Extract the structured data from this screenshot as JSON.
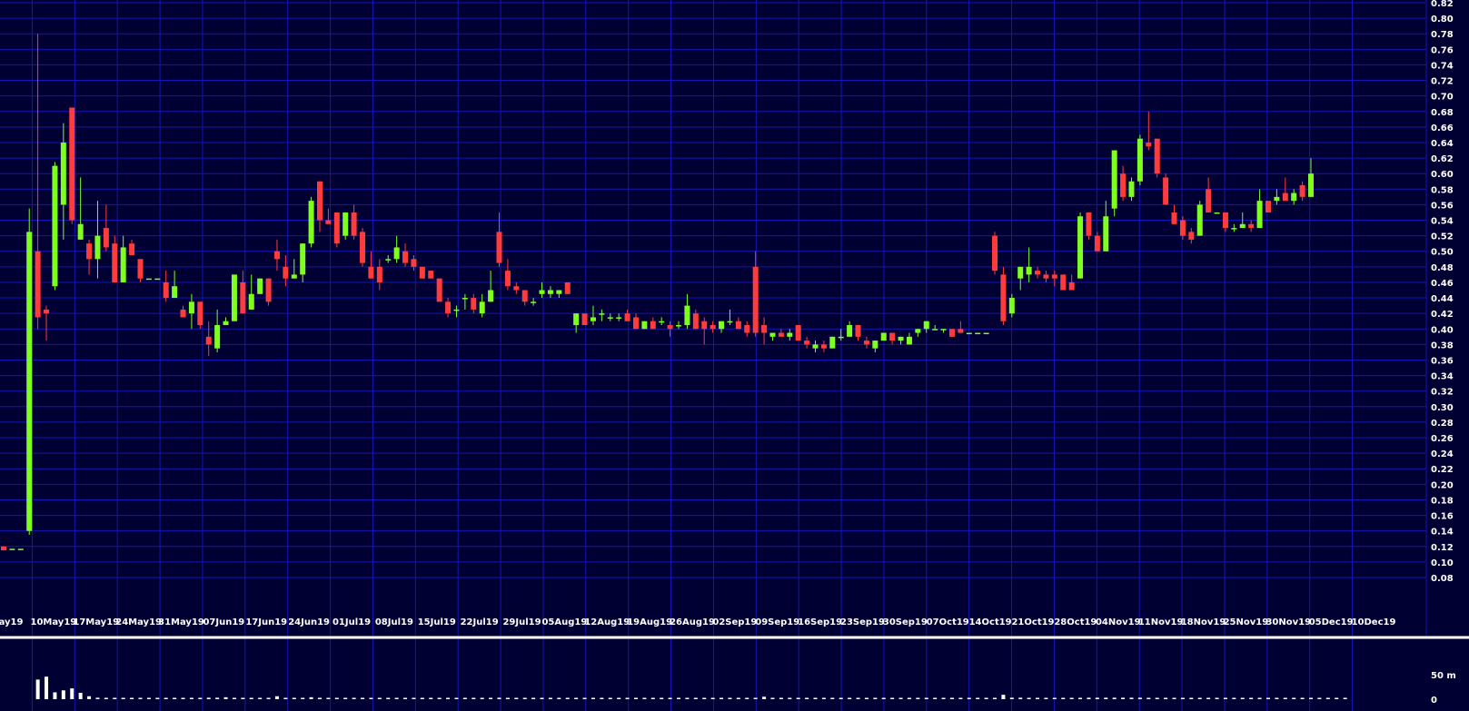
{
  "chart_data": {
    "type": "candlestick",
    "price_axis": {
      "min": 0.08,
      "max": 0.82,
      "tick_step": 0.02,
      "tick_labels": [
        "0.82",
        "0.80",
        "0.78",
        "0.76",
        "0.74",
        "0.72",
        "0.70",
        "0.68",
        "0.66",
        "0.64",
        "0.62",
        "0.60",
        "0.58",
        "0.56",
        "0.54",
        "0.52",
        "0.50",
        "0.48",
        "0.46",
        "0.44",
        "0.42",
        "0.40",
        "0.38",
        "0.36",
        "0.34",
        "0.32",
        "0.30",
        "0.28",
        "0.26",
        "0.24",
        "0.22",
        "0.20",
        "0.18",
        "0.16",
        "0.14",
        "0.12",
        "0.10",
        "0.08"
      ],
      "grid": true
    },
    "date_axis": {
      "labels": [
        "ay19",
        "10May19",
        "17May19",
        "24May19",
        "31May19",
        "07Jun19",
        "17Jun19",
        "24Jun19",
        "01Jul19",
        "08Jul19",
        "15Jul19",
        "22Jul19",
        "29Jul19",
        "05Aug19",
        "12Aug19",
        "19Aug19",
        "26Aug19",
        "02Sep19",
        "09Sep19",
        "16Sep19",
        "23Sep19",
        "30Sep19",
        "07Oct19",
        "14Oct19",
        "21Oct19",
        "28Oct19",
        "04Nov19",
        "11Nov19",
        "18Nov19",
        "25Nov19",
        "30Nov19",
        "05Dec19",
        "10Dec19"
      ]
    },
    "candles": [
      {
        "o": 0.12,
        "h": 0.12,
        "l": 0.115,
        "c": 0.115
      },
      {
        "o": 0.117,
        "h": 0.117,
        "l": 0.117,
        "c": 0.117
      },
      {
        "o": 0.117,
        "h": 0.117,
        "l": 0.117,
        "c": 0.117
      },
      {
        "o": 0.14,
        "h": 0.555,
        "l": 0.135,
        "c": 0.525
      },
      {
        "o": 0.5,
        "h": 0.78,
        "l": 0.4,
        "c": 0.415
      },
      {
        "o": 0.425,
        "h": 0.43,
        "l": 0.385,
        "c": 0.42
      },
      {
        "o": 0.455,
        "h": 0.615,
        "l": 0.45,
        "c": 0.61
      },
      {
        "o": 0.56,
        "h": 0.665,
        "l": 0.515,
        "c": 0.64
      },
      {
        "o": 0.685,
        "h": 0.685,
        "l": 0.535,
        "c": 0.54
      },
      {
        "o": 0.515,
        "h": 0.595,
        "l": 0.515,
        "c": 0.535
      },
      {
        "o": 0.51,
        "h": 0.515,
        "l": 0.47,
        "c": 0.49
      },
      {
        "o": 0.49,
        "h": 0.565,
        "l": 0.465,
        "c": 0.52
      },
      {
        "o": 0.53,
        "h": 0.56,
        "l": 0.5,
        "c": 0.505
      },
      {
        "o": 0.51,
        "h": 0.52,
        "l": 0.46,
        "c": 0.46
      },
      {
        "o": 0.46,
        "h": 0.52,
        "l": 0.46,
        "c": 0.505
      },
      {
        "o": 0.51,
        "h": 0.515,
        "l": 0.495,
        "c": 0.495
      },
      {
        "o": 0.49,
        "h": 0.49,
        "l": 0.46,
        "c": 0.465
      },
      {
        "o": 0.465,
        "h": 0.465,
        "l": 0.465,
        "c": 0.465
      },
      {
        "o": 0.465,
        "h": 0.465,
        "l": 0.465,
        "c": 0.465
      },
      {
        "o": 0.46,
        "h": 0.475,
        "l": 0.435,
        "c": 0.44
      },
      {
        "o": 0.44,
        "h": 0.475,
        "l": 0.44,
        "c": 0.455
      },
      {
        "o": 0.425,
        "h": 0.43,
        "l": 0.415,
        "c": 0.415
      },
      {
        "o": 0.42,
        "h": 0.445,
        "l": 0.4,
        "c": 0.435
      },
      {
        "o": 0.435,
        "h": 0.435,
        "l": 0.4,
        "c": 0.405
      },
      {
        "o": 0.39,
        "h": 0.41,
        "l": 0.365,
        "c": 0.38
      },
      {
        "o": 0.375,
        "h": 0.425,
        "l": 0.37,
        "c": 0.405
      },
      {
        "o": 0.405,
        "h": 0.415,
        "l": 0.405,
        "c": 0.41
      },
      {
        "o": 0.41,
        "h": 0.47,
        "l": 0.41,
        "c": 0.47
      },
      {
        "o": 0.46,
        "h": 0.475,
        "l": 0.42,
        "c": 0.42
      },
      {
        "o": 0.425,
        "h": 0.47,
        "l": 0.425,
        "c": 0.445
      },
      {
        "o": 0.445,
        "h": 0.465,
        "l": 0.445,
        "c": 0.465
      },
      {
        "o": 0.465,
        "h": 0.465,
        "l": 0.43,
        "c": 0.435
      },
      {
        "o": 0.5,
        "h": 0.515,
        "l": 0.475,
        "c": 0.49
      },
      {
        "o": 0.48,
        "h": 0.495,
        "l": 0.455,
        "c": 0.465
      },
      {
        "o": 0.465,
        "h": 0.49,
        "l": 0.465,
        "c": 0.47
      },
      {
        "o": 0.47,
        "h": 0.51,
        "l": 0.46,
        "c": 0.51
      },
      {
        "o": 0.51,
        "h": 0.57,
        "l": 0.505,
        "c": 0.565
      },
      {
        "o": 0.59,
        "h": 0.59,
        "l": 0.525,
        "c": 0.54
      },
      {
        "o": 0.54,
        "h": 0.555,
        "l": 0.535,
        "c": 0.535
      },
      {
        "o": 0.55,
        "h": 0.55,
        "l": 0.505,
        "c": 0.51
      },
      {
        "o": 0.52,
        "h": 0.55,
        "l": 0.515,
        "c": 0.55
      },
      {
        "o": 0.55,
        "h": 0.56,
        "l": 0.515,
        "c": 0.52
      },
      {
        "o": 0.525,
        "h": 0.53,
        "l": 0.48,
        "c": 0.485
      },
      {
        "o": 0.48,
        "h": 0.5,
        "l": 0.465,
        "c": 0.465
      },
      {
        "o": 0.48,
        "h": 0.49,
        "l": 0.45,
        "c": 0.46
      },
      {
        "o": 0.49,
        "h": 0.495,
        "l": 0.485,
        "c": 0.49
      },
      {
        "o": 0.49,
        "h": 0.52,
        "l": 0.485,
        "c": 0.505
      },
      {
        "o": 0.5,
        "h": 0.51,
        "l": 0.48,
        "c": 0.485
      },
      {
        "o": 0.49,
        "h": 0.495,
        "l": 0.475,
        "c": 0.48
      },
      {
        "o": 0.48,
        "h": 0.48,
        "l": 0.465,
        "c": 0.465
      },
      {
        "o": 0.475,
        "h": 0.475,
        "l": 0.465,
        "c": 0.465
      },
      {
        "o": 0.465,
        "h": 0.465,
        "l": 0.435,
        "c": 0.435
      },
      {
        "o": 0.435,
        "h": 0.44,
        "l": 0.415,
        "c": 0.42
      },
      {
        "o": 0.425,
        "h": 0.43,
        "l": 0.415,
        "c": 0.425
      },
      {
        "o": 0.44,
        "h": 0.445,
        "l": 0.425,
        "c": 0.44
      },
      {
        "o": 0.44,
        "h": 0.445,
        "l": 0.42,
        "c": 0.425
      },
      {
        "o": 0.42,
        "h": 0.445,
        "l": 0.415,
        "c": 0.435
      },
      {
        "o": 0.435,
        "h": 0.475,
        "l": 0.435,
        "c": 0.45
      },
      {
        "o": 0.525,
        "h": 0.55,
        "l": 0.48,
        "c": 0.485
      },
      {
        "o": 0.475,
        "h": 0.49,
        "l": 0.45,
        "c": 0.455
      },
      {
        "o": 0.455,
        "h": 0.46,
        "l": 0.445,
        "c": 0.45
      },
      {
        "o": 0.45,
        "h": 0.45,
        "l": 0.43,
        "c": 0.435
      },
      {
        "o": 0.435,
        "h": 0.44,
        "l": 0.43,
        "c": 0.435
      },
      {
        "o": 0.445,
        "h": 0.46,
        "l": 0.44,
        "c": 0.45
      },
      {
        "o": 0.445,
        "h": 0.455,
        "l": 0.44,
        "c": 0.45
      },
      {
        "o": 0.445,
        "h": 0.45,
        "l": 0.44,
        "c": 0.45
      },
      {
        "o": 0.46,
        "h": 0.46,
        "l": 0.445,
        "c": 0.445
      },
      {
        "o": 0.405,
        "h": 0.42,
        "l": 0.395,
        "c": 0.42
      },
      {
        "o": 0.42,
        "h": 0.42,
        "l": 0.405,
        "c": 0.405
      },
      {
        "o": 0.41,
        "h": 0.43,
        "l": 0.405,
        "c": 0.415
      },
      {
        "o": 0.42,
        "h": 0.425,
        "l": 0.41,
        "c": 0.42
      },
      {
        "o": 0.415,
        "h": 0.42,
        "l": 0.41,
        "c": 0.415
      },
      {
        "o": 0.415,
        "h": 0.42,
        "l": 0.41,
        "c": 0.415
      },
      {
        "o": 0.42,
        "h": 0.425,
        "l": 0.41,
        "c": 0.41
      },
      {
        "o": 0.415,
        "h": 0.42,
        "l": 0.4,
        "c": 0.4
      },
      {
        "o": 0.4,
        "h": 0.41,
        "l": 0.4,
        "c": 0.41
      },
      {
        "o": 0.41,
        "h": 0.415,
        "l": 0.4,
        "c": 0.4
      },
      {
        "o": 0.41,
        "h": 0.415,
        "l": 0.405,
        "c": 0.41
      },
      {
        "o": 0.405,
        "h": 0.41,
        "l": 0.39,
        "c": 0.4
      },
      {
        "o": 0.405,
        "h": 0.41,
        "l": 0.4,
        "c": 0.405
      },
      {
        "o": 0.405,
        "h": 0.445,
        "l": 0.4,
        "c": 0.43
      },
      {
        "o": 0.42,
        "h": 0.425,
        "l": 0.4,
        "c": 0.4
      },
      {
        "o": 0.41,
        "h": 0.415,
        "l": 0.38,
        "c": 0.4
      },
      {
        "o": 0.405,
        "h": 0.41,
        "l": 0.395,
        "c": 0.4
      },
      {
        "o": 0.4,
        "h": 0.41,
        "l": 0.395,
        "c": 0.41
      },
      {
        "o": 0.41,
        "h": 0.425,
        "l": 0.405,
        "c": 0.41
      },
      {
        "o": 0.41,
        "h": 0.415,
        "l": 0.4,
        "c": 0.4
      },
      {
        "o": 0.405,
        "h": 0.41,
        "l": 0.39,
        "c": 0.395
      },
      {
        "o": 0.48,
        "h": 0.5,
        "l": 0.39,
        "c": 0.395
      },
      {
        "o": 0.405,
        "h": 0.415,
        "l": 0.38,
        "c": 0.395
      },
      {
        "o": 0.39,
        "h": 0.395,
        "l": 0.385,
        "c": 0.395
      },
      {
        "o": 0.395,
        "h": 0.4,
        "l": 0.39,
        "c": 0.39
      },
      {
        "o": 0.39,
        "h": 0.4,
        "l": 0.385,
        "c": 0.395
      },
      {
        "o": 0.405,
        "h": 0.405,
        "l": 0.385,
        "c": 0.385
      },
      {
        "o": 0.385,
        "h": 0.39,
        "l": 0.375,
        "c": 0.38
      },
      {
        "o": 0.375,
        "h": 0.385,
        "l": 0.37,
        "c": 0.38
      },
      {
        "o": 0.38,
        "h": 0.385,
        "l": 0.37,
        "c": 0.375
      },
      {
        "o": 0.375,
        "h": 0.39,
        "l": 0.375,
        "c": 0.39
      },
      {
        "o": 0.39,
        "h": 0.4,
        "l": 0.385,
        "c": 0.39
      },
      {
        "o": 0.39,
        "h": 0.41,
        "l": 0.39,
        "c": 0.405
      },
      {
        "o": 0.405,
        "h": 0.405,
        "l": 0.385,
        "c": 0.39
      },
      {
        "o": 0.385,
        "h": 0.39,
        "l": 0.375,
        "c": 0.38
      },
      {
        "o": 0.375,
        "h": 0.385,
        "l": 0.37,
        "c": 0.385
      },
      {
        "o": 0.385,
        "h": 0.395,
        "l": 0.385,
        "c": 0.395
      },
      {
        "o": 0.395,
        "h": 0.395,
        "l": 0.38,
        "c": 0.385
      },
      {
        "o": 0.385,
        "h": 0.39,
        "l": 0.38,
        "c": 0.39
      },
      {
        "o": 0.38,
        "h": 0.395,
        "l": 0.38,
        "c": 0.39
      },
      {
        "o": 0.395,
        "h": 0.4,
        "l": 0.39,
        "c": 0.4
      },
      {
        "o": 0.4,
        "h": 0.41,
        "l": 0.395,
        "c": 0.41
      },
      {
        "o": 0.4,
        "h": 0.405,
        "l": 0.4,
        "c": 0.4
      },
      {
        "o": 0.4,
        "h": 0.4,
        "l": 0.395,
        "c": 0.4
      },
      {
        "o": 0.4,
        "h": 0.4,
        "l": 0.39,
        "c": 0.39
      },
      {
        "o": 0.4,
        "h": 0.41,
        "l": 0.395,
        "c": 0.395
      },
      {
        "o": 0.395,
        "h": 0.395,
        "l": 0.395,
        "c": 0.395
      },
      {
        "o": 0.395,
        "h": 0.395,
        "l": 0.395,
        "c": 0.395
      },
      {
        "o": 0.395,
        "h": 0.395,
        "l": 0.395,
        "c": 0.395
      },
      {
        "o": 0.52,
        "h": 0.525,
        "l": 0.47,
        "c": 0.475
      },
      {
        "o": 0.47,
        "h": 0.48,
        "l": 0.405,
        "c": 0.41
      },
      {
        "o": 0.42,
        "h": 0.445,
        "l": 0.415,
        "c": 0.44
      },
      {
        "o": 0.465,
        "h": 0.48,
        "l": 0.45,
        "c": 0.48
      },
      {
        "o": 0.47,
        "h": 0.505,
        "l": 0.46,
        "c": 0.48
      },
      {
        "o": 0.475,
        "h": 0.48,
        "l": 0.465,
        "c": 0.47
      },
      {
        "o": 0.47,
        "h": 0.475,
        "l": 0.46,
        "c": 0.465
      },
      {
        "o": 0.47,
        "h": 0.475,
        "l": 0.455,
        "c": 0.465
      },
      {
        "o": 0.47,
        "h": 0.47,
        "l": 0.45,
        "c": 0.45
      },
      {
        "o": 0.46,
        "h": 0.47,
        "l": 0.45,
        "c": 0.45
      },
      {
        "o": 0.465,
        "h": 0.55,
        "l": 0.465,
        "c": 0.545
      },
      {
        "o": 0.55,
        "h": 0.55,
        "l": 0.515,
        "c": 0.52
      },
      {
        "o": 0.52,
        "h": 0.525,
        "l": 0.5,
        "c": 0.5
      },
      {
        "o": 0.5,
        "h": 0.565,
        "l": 0.5,
        "c": 0.545
      },
      {
        "o": 0.555,
        "h": 0.63,
        "l": 0.545,
        "c": 0.63
      },
      {
        "o": 0.6,
        "h": 0.61,
        "l": 0.565,
        "c": 0.57
      },
      {
        "o": 0.57,
        "h": 0.595,
        "l": 0.565,
        "c": 0.59
      },
      {
        "o": 0.59,
        "h": 0.65,
        "l": 0.585,
        "c": 0.645
      },
      {
        "o": 0.64,
        "h": 0.68,
        "l": 0.63,
        "c": 0.635
      },
      {
        "o": 0.645,
        "h": 0.645,
        "l": 0.595,
        "c": 0.6
      },
      {
        "o": 0.595,
        "h": 0.6,
        "l": 0.56,
        "c": 0.56
      },
      {
        "o": 0.55,
        "h": 0.56,
        "l": 0.535,
        "c": 0.535
      },
      {
        "o": 0.54,
        "h": 0.545,
        "l": 0.515,
        "c": 0.52
      },
      {
        "o": 0.525,
        "h": 0.53,
        "l": 0.51,
        "c": 0.515
      },
      {
        "o": 0.52,
        "h": 0.565,
        "l": 0.52,
        "c": 0.56
      },
      {
        "o": 0.58,
        "h": 0.595,
        "l": 0.55,
        "c": 0.55
      },
      {
        "o": 0.55,
        "h": 0.55,
        "l": 0.55,
        "c": 0.55
      },
      {
        "o": 0.55,
        "h": 0.55,
        "l": 0.525,
        "c": 0.53
      },
      {
        "o": 0.53,
        "h": 0.535,
        "l": 0.525,
        "c": 0.53
      },
      {
        "o": 0.53,
        "h": 0.55,
        "l": 0.53,
        "c": 0.535
      },
      {
        "o": 0.535,
        "h": 0.54,
        "l": 0.525,
        "c": 0.53
      },
      {
        "o": 0.53,
        "h": 0.58,
        "l": 0.53,
        "c": 0.565
      },
      {
        "o": 0.565,
        "h": 0.565,
        "l": 0.55,
        "c": 0.55
      },
      {
        "o": 0.565,
        "h": 0.58,
        "l": 0.56,
        "c": 0.57
      },
      {
        "o": 0.575,
        "h": 0.595,
        "l": 0.565,
        "c": 0.565
      },
      {
        "o": 0.565,
        "h": 0.58,
        "l": 0.56,
        "c": 0.575
      },
      {
        "o": 0.585,
        "h": 0.59,
        "l": 0.565,
        "c": 0.57
      },
      {
        "o": 0.57,
        "h": 0.62,
        "l": 0.57,
        "c": 0.6
      }
    ],
    "volume": {
      "tick_labels": [
        "50 m",
        "0"
      ],
      "axis_max_m": 50,
      "values_m": [
        0,
        0,
        0,
        0,
        40,
        46,
        14,
        18,
        22,
        13,
        6,
        3,
        2,
        2,
        2,
        2,
        2,
        2,
        1,
        1,
        1,
        2,
        2,
        2,
        3,
        3,
        4,
        2,
        2,
        2,
        2,
        2,
        6,
        2,
        2,
        2,
        4,
        2,
        2,
        2,
        2,
        2,
        2,
        2,
        2,
        2,
        2,
        2,
        2,
        2,
        2,
        2,
        2,
        2,
        2,
        2,
        2,
        2,
        3,
        2,
        2,
        2,
        2,
        2,
        2,
        2,
        2,
        2,
        2,
        2,
        1,
        1,
        1,
        1,
        1,
        1,
        1,
        1,
        1,
        1,
        1,
        1,
        1,
        1,
        1,
        1,
        1,
        1,
        1,
        5,
        2,
        2,
        2,
        2,
        2,
        2,
        2,
        2,
        2,
        2,
        2,
        2,
        2,
        2,
        2,
        2,
        2,
        2,
        2,
        2,
        2,
        2,
        2,
        2,
        2,
        2,
        2,
        9,
        3,
        3,
        2,
        2,
        2,
        2,
        2,
        2,
        2,
        3,
        3,
        3,
        3,
        3,
        3,
        3,
        2,
        2,
        2,
        2,
        2,
        2,
        2,
        2,
        2,
        2,
        2,
        2,
        2,
        2,
        2,
        2,
        2,
        2,
        2,
        2,
        2,
        2,
        2,
        2
      ]
    },
    "colors": {
      "background": "#000033",
      "grid": "#1515b8",
      "up": "#7fff1f",
      "down": "#ff3b3b",
      "axis_text": "#ffffff",
      "volume": "#ffffff",
      "separator": "#ffffff"
    }
  }
}
